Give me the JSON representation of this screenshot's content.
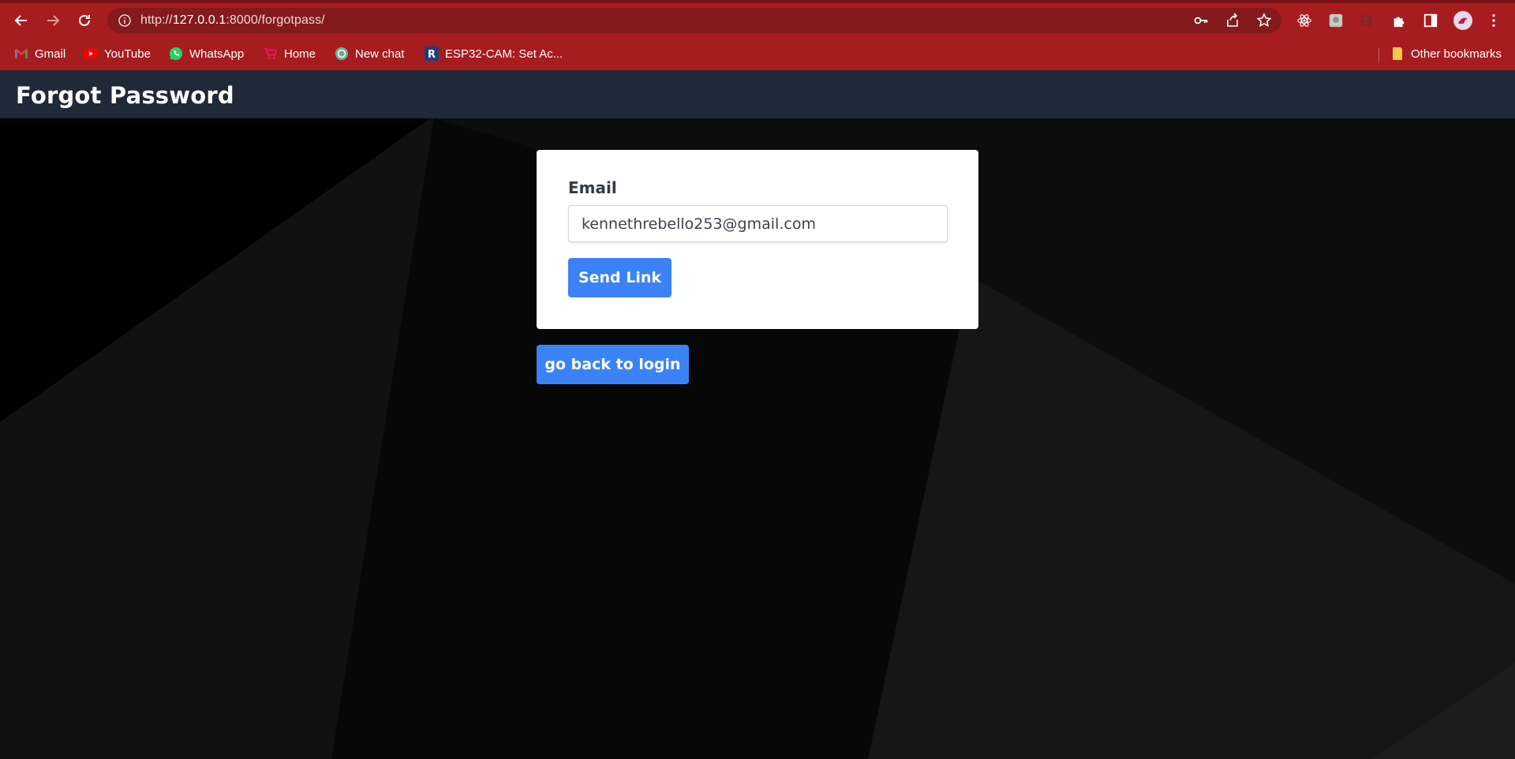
{
  "browser": {
    "url_prefix": "http://",
    "url_host": "127.0.0.1",
    "url_rest": ":8000/forgotpass/",
    "bookmarks": [
      {
        "label": "Gmail",
        "icon": "gmail-icon"
      },
      {
        "label": "YouTube",
        "icon": "youtube-icon"
      },
      {
        "label": "WhatsApp",
        "icon": "whatsapp-icon"
      },
      {
        "label": "Home",
        "icon": "cart-icon"
      },
      {
        "label": "New chat",
        "icon": "chatgpt-icon"
      },
      {
        "label": "ESP32-CAM: Set Ac...",
        "icon": "r-icon"
      }
    ],
    "other_bookmarks": "Other bookmarks"
  },
  "header": {
    "title": "Forgot Password"
  },
  "form": {
    "email_label": "Email",
    "email_value": "kennethrebello253@gmail.com",
    "send_button": "Send Link"
  },
  "back_button": "go back to login",
  "colors": {
    "chrome": "#a61c1f",
    "header": "#1f2937",
    "button": "#3b82f6"
  }
}
